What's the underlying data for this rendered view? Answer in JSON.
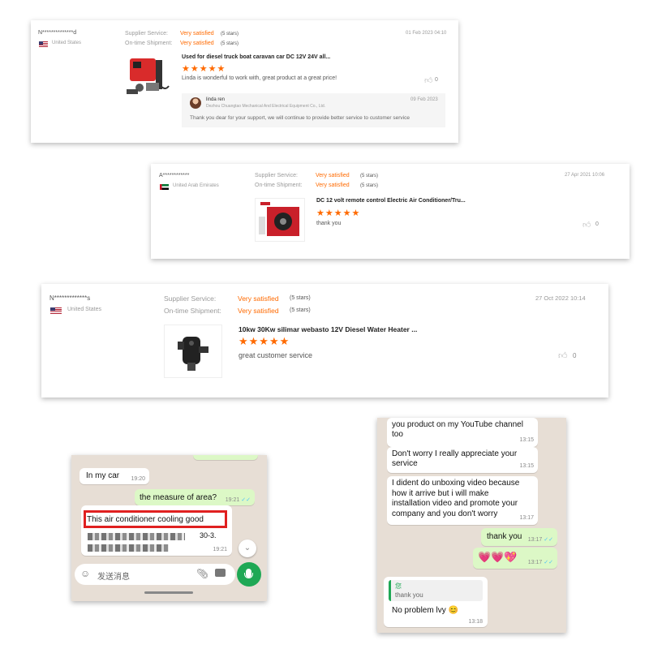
{
  "reviews": [
    {
      "user": "N**************d",
      "country": "United States",
      "supplier_label": "Supplier Service:",
      "supplier_value": "Very satisfied",
      "supplier_stars": "(5 stars)",
      "shipment_label": "On-time Shipment:",
      "shipment_value": "Very satisfied",
      "shipment_stars": "(5 stars)",
      "date": "01 Feb 2023 04:10",
      "product": "Used for diesel truck boat caravan car DC 12V 24V all...",
      "rating": "★★★★★",
      "comment": "Linda is wonderful to work with, great product at a great price!",
      "likes": "0",
      "reply": {
        "name": "linda ren",
        "company": "Dezhou Chuangtao Mechanical And Electrical Equipment Co., Ltd.",
        "date": "09 Feb 2023",
        "text": "Thank you dear for your support, we will continue to provide better service to customer service"
      }
    },
    {
      "user": "A************",
      "country": "United Arab Emirates",
      "supplier_label": "Supplier Service:",
      "supplier_value": "Very satisfied",
      "supplier_stars": "(5 stars)",
      "shipment_label": "On-time Shipment:",
      "shipment_value": "Very satisfied",
      "shipment_stars": "(5 stars)",
      "date": "27 Apr 2021 10:06",
      "product": "DC 12 volt remote control Electric Air Conditioner/Tru...",
      "rating": "★★★★★",
      "comment": "thank you",
      "likes": "0"
    },
    {
      "user": "N*************s",
      "country": "United States",
      "supplier_label": "Supplier Service:",
      "supplier_value": "Very satisfied",
      "supplier_stars": "(5 stars)",
      "shipment_label": "On-time Shipment:",
      "shipment_value": "Very satisfied",
      "shipment_stars": "(5 stars)",
      "date": "27 Oct 2022 10:14",
      "product": "10kw 30Kw silimar webasto 12V Diesel Water Heater ...",
      "rating": "★★★★★",
      "comment": "great customer service",
      "likes": "0"
    }
  ],
  "chat_left": {
    "m1": "In my car",
    "m1_time": "19:20",
    "m2": "the measure of area?",
    "m2_time": "19:21",
    "m3": "This air conditioner cooling good",
    "m3_tail": "30-3.",
    "m3_time": "19:21",
    "input_placeholder": "发送消息",
    "colors": {
      "highlight": "#e02020",
      "send": "#1fa855"
    }
  },
  "chat_right": {
    "m1": "you product on my YouTube channel too",
    "m1_time": "13:15",
    "m2": "Don't worry I really appreciate your service",
    "m2_time": "13:15",
    "m3": "I dident do unboxing video because how it arrive but i will make installation video and promote your company and you don't worry",
    "m3_time": "13:17",
    "m4": "thank you",
    "m4_time": "13:17",
    "m5": "💗💗💖",
    "m5_time": "13:17",
    "quote_name": "您",
    "quote_text": "thank you",
    "m6": "No problem lvy 😊",
    "m6_time": "13:18"
  }
}
